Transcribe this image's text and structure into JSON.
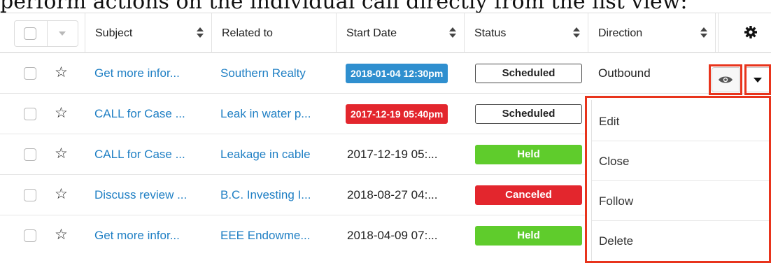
{
  "caption": "perform actions on the individual call directly from the list view:",
  "header": {
    "columns": [
      {
        "key": "subject",
        "label": "Subject"
      },
      {
        "key": "related",
        "label": "Related to"
      },
      {
        "key": "start",
        "label": "Start Date"
      },
      {
        "key": "status",
        "label": "Status"
      },
      {
        "key": "direction",
        "label": "Direction"
      }
    ],
    "settings_icon": "gear-icon"
  },
  "rows": [
    {
      "subject": "Get more infor...",
      "related": "Southern Realty",
      "start": "2018-01-04 12:30pm",
      "start_style": "blue-badge",
      "status": "Scheduled",
      "status_style": "outline",
      "direction": "Outbound"
    },
    {
      "subject": "CALL for Case ...",
      "related": "Leak in water p...",
      "start": "2017-12-19 05:40pm",
      "start_style": "red-badge",
      "status": "Scheduled",
      "status_style": "outline",
      "direction": ""
    },
    {
      "subject": "CALL for Case ...",
      "related": "Leakage in cable",
      "start": "2017-12-19 05:...",
      "start_style": "plain",
      "status": "Held",
      "status_style": "green",
      "direction": ""
    },
    {
      "subject": "Discuss review ...",
      "related": "B.C. Investing I...",
      "start": "2018-08-27 04:...",
      "start_style": "plain",
      "status": "Canceled",
      "status_style": "red",
      "direction": ""
    },
    {
      "subject": "Get more infor...",
      "related": "EEE Endowme...",
      "start": "2018-04-09 07:...",
      "start_style": "plain",
      "status": "Held",
      "status_style": "green",
      "direction": ""
    }
  ],
  "row_actions": {
    "preview_icon": "eye-icon",
    "menu_icon": "caret-down-icon"
  },
  "menu": {
    "items": [
      "Edit",
      "Close",
      "Follow",
      "Delete"
    ]
  },
  "colors": {
    "link": "#1f7fc4",
    "badge_blue": "#2f8fcf",
    "badge_red": "#e3262d",
    "held_green": "#5fcc2c",
    "canceled_red": "#e3262d",
    "highlight": "#e8341c"
  }
}
